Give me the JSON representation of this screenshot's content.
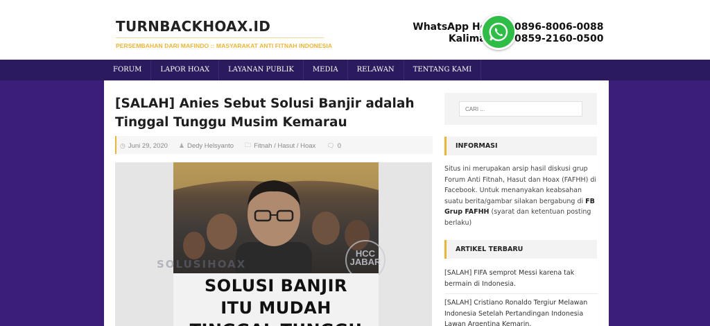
{
  "header": {
    "site_title": "TURNBACKHOAX.ID",
    "tagline": "PERSEMBAHAN DARI MAFINDO :: MASYARAKAT ANTI FITNAH INDONESIA",
    "whatsapp_label_1": "WhatsApp Hotline",
    "whatsapp_label_2": "Kalimasada",
    "phone_1": "0896-8006-0088",
    "phone_2": "0859-2160-0500",
    "whatsapp_icon": "whatsapp-icon"
  },
  "nav": {
    "items": [
      {
        "label": "FORUM"
      },
      {
        "label": "LAPOR HOAX"
      },
      {
        "label": "LAYANAN PUBLIK"
      },
      {
        "label": "MEDIA"
      },
      {
        "label": "RELAWAN"
      },
      {
        "label": "TENTANG KAMI"
      }
    ]
  },
  "article": {
    "title": "[SALAH] Anies Sebut Solusi Banjir adalah Tinggal Tunggu Musim Kemarau",
    "meta": {
      "date": "Juni 29, 2020",
      "author": "Dedy Helsyanto",
      "categories": "Fitnah / Hasut / Hoax",
      "comments": "0"
    },
    "image": {
      "line_1": "SOLUSI BANJIR",
      "line_2": "ITU MUDAH",
      "line_3": "TINGGAL TUNGGU",
      "watermark": "SOLUSIHOAX",
      "badge": "HCC JABAR"
    }
  },
  "sidebar": {
    "search_placeholder": "CARI ...",
    "informasi_title": "INFORMASI",
    "informasi_text_1": "Situs ini merupakan arsip hasil diskusi grup Forum Anti Fitnah, Hasut dan Hoax (FAFHH) di Facebook. Untuk menanyakan keabsahan suatu berita/gambar silakan bergabung di ",
    "informasi_link": "FB Grup FAFHH",
    "informasi_text_2": " (syarat dan ketentuan posting berlaku)",
    "recent_title": "ARTIKEL TERBARU",
    "recent": [
      {
        "title": "[SALAH] FIFA semprot Messi karena tak bermain di Indonesia."
      },
      {
        "title": "[SALAH] Cristiano Ronaldo Tergiur Melawan Indonesia Setelah Pertandingan Indonesia Lawan Argentina Kemarin."
      }
    ]
  },
  "colors": {
    "nav_bg": "#2b1a5d",
    "page_bg": "#3a1e79",
    "accent": "#f1b42f",
    "whatsapp": "#2fbe45"
  }
}
